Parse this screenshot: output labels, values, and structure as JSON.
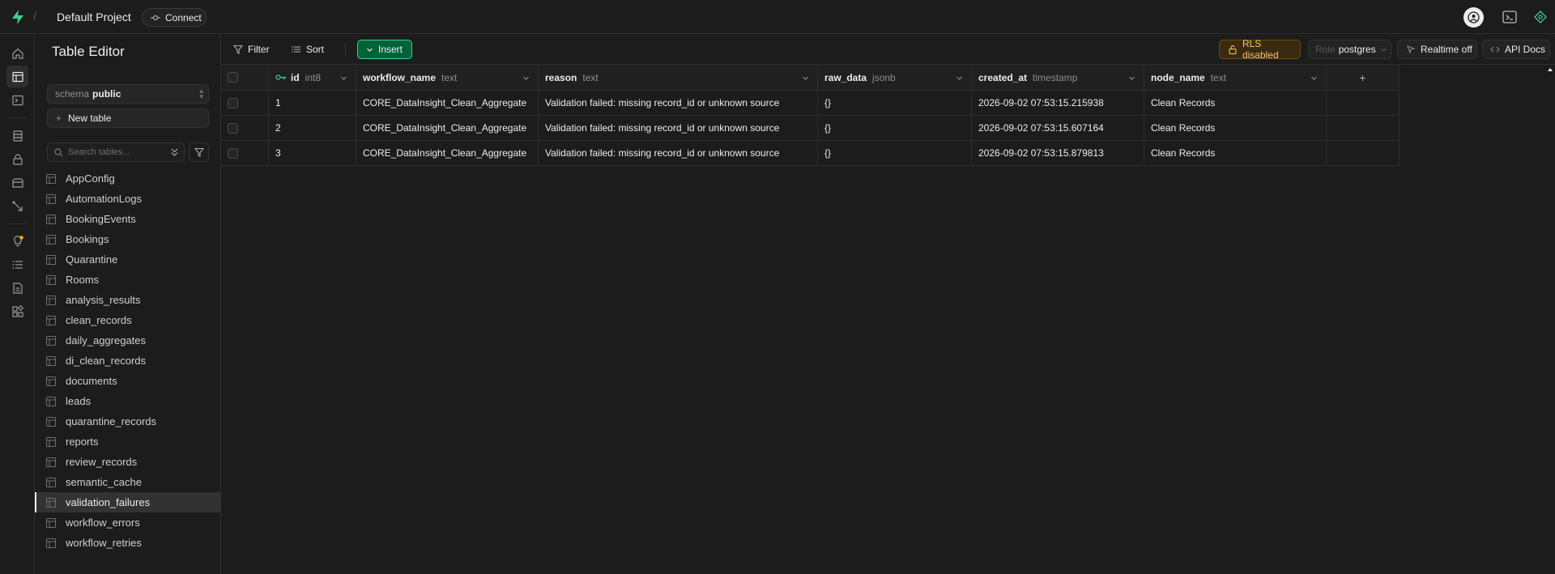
{
  "header": {
    "project_name": "Default Project",
    "connect_label": "Connect"
  },
  "sidebar": {
    "title": "Table Editor",
    "schema_key": "schema",
    "schema_value": "public",
    "new_table_label": "New table",
    "search_placeholder": "Search tables...",
    "tables": [
      "AppConfig",
      "AutomationLogs",
      "BookingEvents",
      "Bookings",
      "Quarantine",
      "Rooms",
      "analysis_results",
      "clean_records",
      "daily_aggregates",
      "di_clean_records",
      "documents",
      "leads",
      "quarantine_records",
      "reports",
      "review_records",
      "semantic_cache",
      "validation_failures",
      "workflow_errors",
      "workflow_retries"
    ],
    "active_table": "validation_failures"
  },
  "toolbar": {
    "filter_label": "Filter",
    "sort_label": "Sort",
    "insert_label": "Insert",
    "rls_label": "RLS disabled",
    "role_key": "Role",
    "role_value": "postgres",
    "realtime_label": "Realtime off",
    "api_docs_label": "API Docs"
  },
  "table": {
    "columns": [
      {
        "name": "id",
        "type": "int8",
        "primary_key": true
      },
      {
        "name": "workflow_name",
        "type": "text"
      },
      {
        "name": "reason",
        "type": "text"
      },
      {
        "name": "raw_data",
        "type": "jsonb"
      },
      {
        "name": "created_at",
        "type": "timestamp"
      },
      {
        "name": "node_name",
        "type": "text"
      }
    ],
    "rows": [
      {
        "id": "1",
        "workflow_name": "CORE_DataInsight_Clean_Aggregate",
        "reason": "Validation failed: missing record_id or unknown source",
        "raw_data": "{}",
        "created_at": "2026-09-02 07:53:15.215938",
        "node_name": "Clean Records"
      },
      {
        "id": "2",
        "workflow_name": "CORE_DataInsight_Clean_Aggregate",
        "reason": "Validation failed: missing record_id or unknown source",
        "raw_data": "{}",
        "created_at": "2026-09-02 07:53:15.607164",
        "node_name": "Clean Records"
      },
      {
        "id": "3",
        "workflow_name": "CORE_DataInsight_Clean_Aggregate",
        "reason": "Validation failed: missing record_id or unknown source",
        "raw_data": "{}",
        "created_at": "2026-09-02 07:53:15.879813",
        "node_name": "Clean Records"
      }
    ]
  },
  "colors": {
    "brand_green": "#3ecf8e",
    "insert_bg": "#006239",
    "rls_warning": "#f5c471"
  }
}
